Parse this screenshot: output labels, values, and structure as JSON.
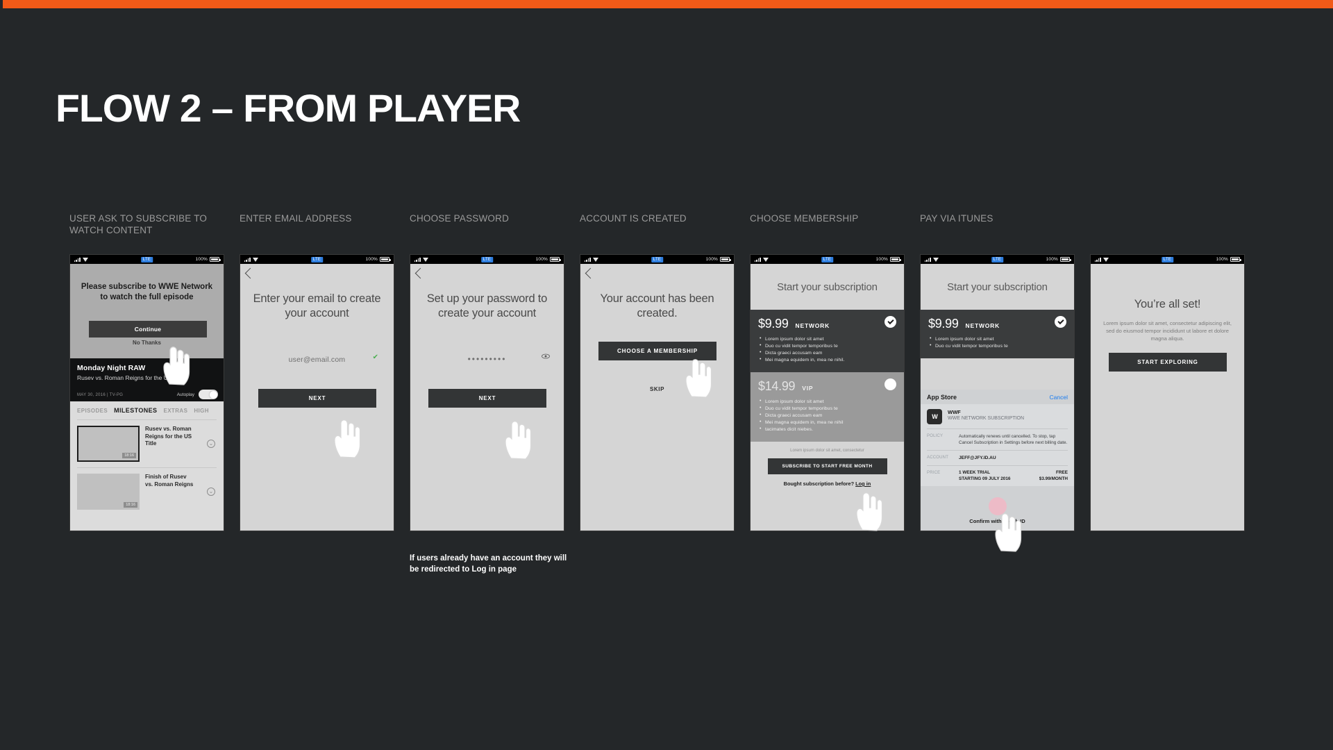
{
  "theme": {
    "background": "#242729",
    "accent": "#f15a18",
    "text": "#ffffff",
    "label": "#9a9a9a"
  },
  "header": {
    "title": "FLOW 2 – FROM PLAYER"
  },
  "columns": [
    {
      "label": "USER ASK TO SUBSCRIBE TO WATCH CONTENT"
    },
    {
      "label": "ENTER EMAIL ADDRESS"
    },
    {
      "label": "CHOOSE PASSWORD"
    },
    {
      "label": "ACCOUNT IS CREATED"
    },
    {
      "label": "CHOOSE MEMBERSHIP"
    },
    {
      "label": "PAY VIA ITUNES"
    }
  ],
  "statusbar": {
    "carrier": "LTE",
    "battery": "100%"
  },
  "screen1": {
    "message": "Please subscribe to WWE Network to watch the full episode",
    "continue_label": "Continue",
    "no_thanks_label": "No Thanks",
    "video_title": "Monday Night RAW",
    "video_subtitle": "Rusev vs. Roman Reigns for the US Title",
    "meta": "MAY 30, 2016  |  TV-PG",
    "autoplay_label": "Autoplay",
    "tabs": [
      "EPISODES",
      "MILESTONES",
      "EXTRAS",
      "HIGH"
    ],
    "active_tab": "MILESTONES",
    "rows": [
      {
        "title": "Rusev vs. Roman Reigns for the US Title",
        "duration": "18:16",
        "selected": true
      },
      {
        "title": "Finish of Rusev vs. Roman Reigns",
        "duration": "18:16",
        "selected": false
      }
    ]
  },
  "screen2": {
    "headline": "Enter your email to create your account",
    "email_value": "user@email.com",
    "next_label": "NEXT"
  },
  "screen3": {
    "headline": "Set up your password to create your account",
    "password_value": "•••••••••",
    "next_label": "NEXT",
    "note": "If users already have an account they will be redirected to Log in page"
  },
  "screen4": {
    "headline": "Your account has been created.",
    "cta_label": "CHOOSE A MEMBERSHIP",
    "skip_label": "SKIP"
  },
  "subscription": {
    "header": "Start your subscription",
    "plans": [
      {
        "price": "$9.99",
        "tier": "NETWORK",
        "selected": true,
        "features": [
          "Lorem ipsum dolor sit amet",
          "Duo cu vidit tempor temporibus te",
          "Dicta graeci accusam eam",
          "Mei magna equidem in, mea ne nihil."
        ]
      },
      {
        "price": "$14.99",
        "tier": "VIP",
        "selected": false,
        "features": [
          "Lorem ipsum dolor sit amet",
          "Duo cu vidit tempor temporibus te",
          "Dicta graeci accusam eam",
          "Mei magna equidem in, mea ne nihil",
          "tacimates dicit niebes."
        ]
      }
    ],
    "footer_lorem": "Lorem ipsum dolor sit amet, consectetur",
    "cta_label": "SUBSCRIBE TO START FREE MONTH",
    "bought_text": "Bought subscription before? ",
    "bought_link": "Log in"
  },
  "appstore": {
    "title": "App Store",
    "cancel_label": "Cancel",
    "app_name": "WWF",
    "app_subtitle": "WWE NETWORK SUBSCRIPTION",
    "policy_key": "POLICY",
    "policy_value": "Automatically renews until cancelled. To stop, tap Cancel Subscription in Settings before next billing date.",
    "account_key": "ACCOUNT",
    "account_value": "JEFF@JFY.ID.AU",
    "price_key": "PRICE",
    "trial_label": "1 WEEK TRIAL",
    "trial_value": "FREE",
    "starting_label": "STARTING 09 JULY 2016",
    "starting_value": "$3.99/MONTH",
    "confirm_text": "Confirm with Touch ID"
  },
  "screen7": {
    "headline": "You’re all set!",
    "body": "Lorem ipsum dolor sit amet, consectetur adipiscing elit, sed do eiusmod tempor incididunt ut labore et dolore magna aliqua.",
    "cta_label": "START EXPLORING"
  }
}
